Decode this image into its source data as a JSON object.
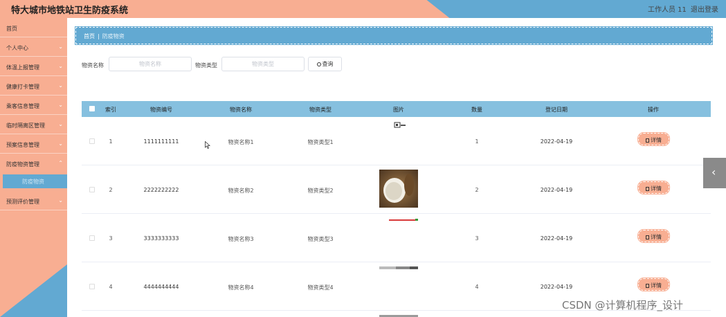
{
  "header": {
    "title": "特大城市地铁站卫生防疫系统",
    "user": "工作人员 11",
    "logout": "退出登录"
  },
  "sidebar": {
    "items": [
      {
        "label": "首页",
        "has_chevron": false
      },
      {
        "label": "个人中心",
        "has_chevron": true
      },
      {
        "label": "体温上报管理",
        "has_chevron": true
      },
      {
        "label": "健康打卡管理",
        "has_chevron": true
      },
      {
        "label": "乘客信息管理",
        "has_chevron": true
      },
      {
        "label": "临时隔离区管理",
        "has_chevron": true
      },
      {
        "label": "预案信息管理",
        "has_chevron": true
      },
      {
        "label": "防疫物资管理",
        "has_chevron": true
      },
      {
        "label": "预测评价管理",
        "has_chevron": true
      }
    ],
    "active_sub": "防疫物资"
  },
  "breadcrumb": {
    "home": "首页",
    "separator": "|",
    "current": "防疫物资"
  },
  "search": {
    "name_label": "物资名称",
    "name_placeholder": "物资名称",
    "type_label": "物资类型",
    "type_placeholder": "物资类型",
    "button": "查询"
  },
  "table": {
    "headers": [
      "索引",
      "物资编号",
      "物资名称",
      "物资类型",
      "图片",
      "数量",
      "登记日期",
      "操作"
    ],
    "detail_label": "详情",
    "rows": [
      {
        "index": "1",
        "code": "1111111111",
        "name": "物资名称1",
        "type": "物资类型1",
        "qty": "1",
        "date": "2022-04-19"
      },
      {
        "index": "2",
        "code": "2222222222",
        "name": "物资名称2",
        "type": "物资类型2",
        "qty": "2",
        "date": "2022-04-19"
      },
      {
        "index": "3",
        "code": "3333333333",
        "name": "物资名称3",
        "type": "物资类型3",
        "qty": "3",
        "date": "2022-04-19"
      },
      {
        "index": "4",
        "code": "4444444444",
        "name": "物资名称4",
        "type": "物资类型4",
        "qty": "4",
        "date": "2022-04-19"
      }
    ]
  },
  "watermark": "CSDN @计算机程序_设计",
  "colors": {
    "salmon": "#f8ae92",
    "blue": "#62a9d2",
    "table_header": "#86c0df"
  },
  "icons": {
    "search": "search-icon",
    "detail": "document-icon",
    "toggle": "chevron-left-icon"
  }
}
